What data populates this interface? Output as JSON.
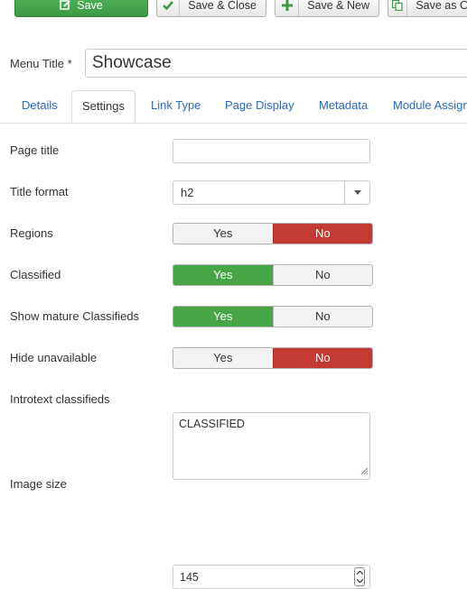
{
  "toolbar": {
    "save_label": "Save",
    "save_close_label": "Save & Close",
    "save_new_label": "Save & New",
    "save_copy_label": "Save as C"
  },
  "menu_title": {
    "label": "Menu Title *",
    "value": "Showcase"
  },
  "tabs": [
    {
      "label": "Details"
    },
    {
      "label": "Settings"
    },
    {
      "label": "Link Type"
    },
    {
      "label": "Page Display"
    },
    {
      "label": "Metadata"
    },
    {
      "label": "Module Assign"
    }
  ],
  "form": {
    "page_title": {
      "label": "Page title",
      "value": ""
    },
    "title_format": {
      "label": "Title format",
      "value": "h2"
    },
    "regions": {
      "label": "Regions",
      "yes": "Yes",
      "no": "No",
      "selected": "No"
    },
    "classified": {
      "label": "Classified",
      "yes": "Yes",
      "no": "No",
      "selected": "Yes"
    },
    "show_mature": {
      "label": "Show mature Classifieds",
      "yes": "Yes",
      "no": "No",
      "selected": "Yes"
    },
    "hide_unavailable": {
      "label": "Hide unavailable",
      "yes": "Yes",
      "no": "No",
      "selected": "No"
    },
    "introtext": {
      "label": "Introtext classifieds",
      "value": "CLASSIFIED"
    },
    "image_size": {
      "label": "Image size",
      "value": "145"
    }
  },
  "colors": {
    "save_green": "#46a546",
    "no_red": "#c23a31",
    "link_blue": "#2a69b8"
  }
}
